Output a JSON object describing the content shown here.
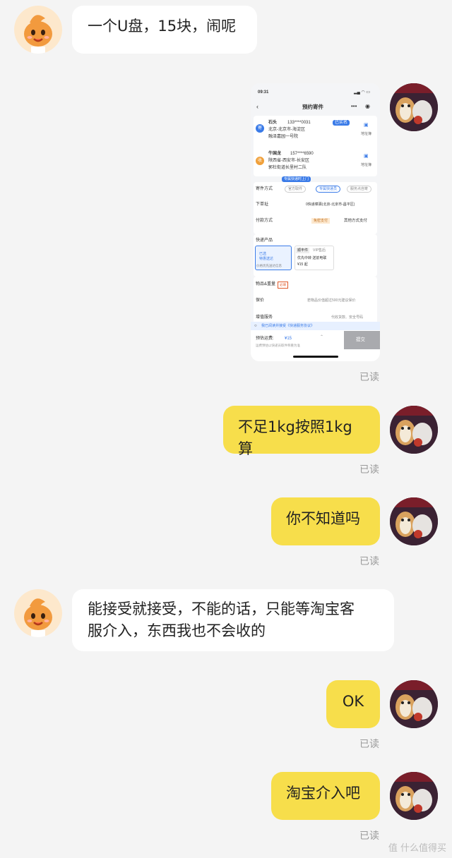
{
  "messages": [
    {
      "text": "一个U盘，15块，闹呢"
    },
    {
      "read": "已读"
    },
    {
      "text": "不足1kg按照1kg算",
      "read": "已读"
    },
    {
      "text": "你不知道吗",
      "read": "已读"
    },
    {
      "text_line1": "能接受就接受，不能的话，只能等淘宝客",
      "text_line2": "服介入，东西我也不会收的"
    },
    {
      "text": "OK",
      "read": "已读"
    },
    {
      "text": "淘宝介入吧",
      "read": "已读"
    }
  ],
  "screenshot": {
    "time": "09:31",
    "title": "预约寄件",
    "sender": {
      "badge": "寄",
      "name": "石头",
      "phone": "133****0031",
      "tag": "已实名",
      "address1": "北京-北京市-海淀区",
      "address2": "融泽嘉园一号院",
      "book": "地址簿"
    },
    "receiver": {
      "badge": "收",
      "name": "牛国龙",
      "phone": "157****6590",
      "address1": "陕西省-西安市-长安区",
      "address2": "郭杜街道长里村二队",
      "book": "地址簿"
    },
    "tooltip": "专属快递时上门",
    "send_method": {
      "label": "寄件方式",
      "options": [
        "官方取件",
        "专属快递员",
        "服务点自寄"
      ]
    },
    "pickup": {
      "label": "下单址",
      "value": "0快递菜驿(北京-北京市-昌平区)"
    },
    "payment": {
      "label": "付款方式",
      "tag": "免密支付",
      "value": "其他方式支付"
    },
    "product": {
      "label": "快递产品",
      "option1_line1": "已选",
      "option1_line2": "特惠送达",
      "option1_note": "价格优先送达信息",
      "option2_name": "顺丰件",
      "option2_tag": "VIP售后",
      "option2_desc": "优先中转 送前电联",
      "option2_price": "¥15 起"
    },
    "weight": {
      "label": "物品&重量",
      "tag": "必填"
    },
    "insurance": {
      "label": "保价",
      "value": "若物品价值超过500元建议保价"
    },
    "extra": {
      "label": "增值服务",
      "value": "代收货款、安全号码"
    },
    "agreement": "我已阅读并接受《快递服务协议》",
    "fee": {
      "label": "预估运费:",
      "value": "¥15",
      "note": "运费预估以快递员取件称重为准"
    },
    "submit": "提交"
  },
  "watermark": "值 什么值得买",
  "colors": {
    "bubble_out": "#f7de4b",
    "bubble_in": "#ffffff",
    "background": "#f4f4f4",
    "accent_blue": "#3a7be8"
  }
}
